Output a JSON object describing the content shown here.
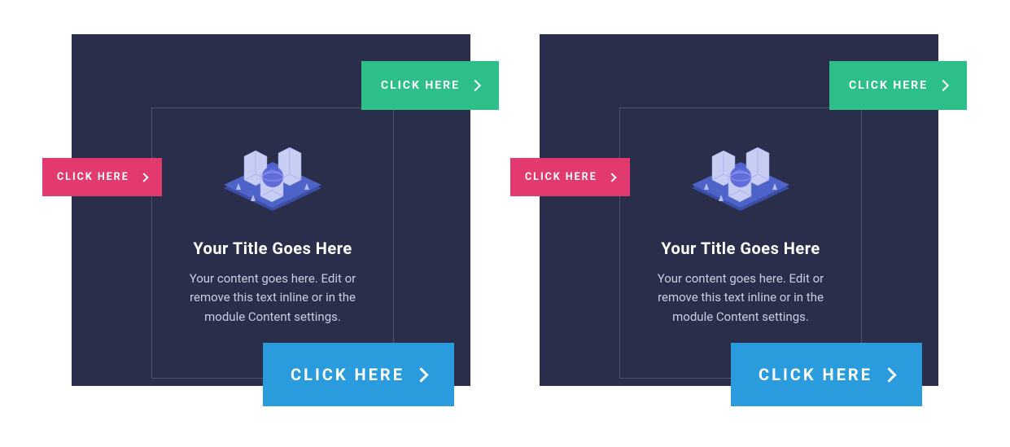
{
  "cards": [
    {
      "title": "Your Title Goes Here",
      "description": "Your content goes here. Edit or remove this text inline or in the module Content settings.",
      "btn_green": "CLICK HERE",
      "btn_pink": "CLICK HERE",
      "btn_blue": "CLICK HERE"
    },
    {
      "title": "Your Title Goes Here",
      "description": "Your content goes here. Edit or remove this text inline or in the module Content settings.",
      "btn_green": "CLICK HERE",
      "btn_pink": "CLICK HERE",
      "btn_blue": "CLICK HERE"
    }
  ],
  "colors": {
    "card_bg": "#2b2e4a",
    "green": "#2cbf89",
    "pink": "#e23a6e",
    "blue": "#2a9cdd"
  }
}
